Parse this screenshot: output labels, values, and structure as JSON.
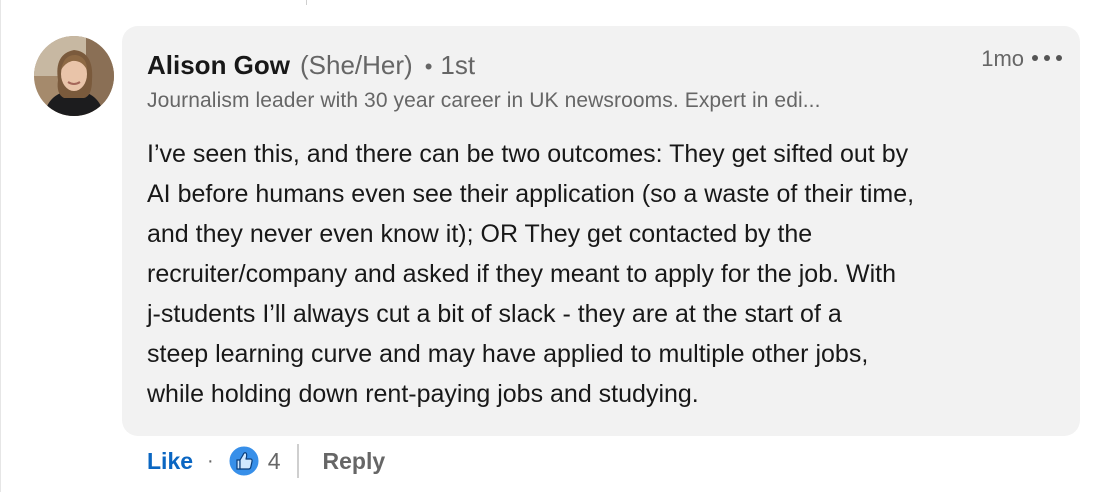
{
  "author": {
    "name": "Alison Gow",
    "pronouns": "(She/Her)",
    "separator": "•",
    "degree": "1st",
    "headline": "Journalism leader with 30 year career in UK newsrooms. Expert in edi...",
    "avatar_icon": "profile-photo"
  },
  "meta": {
    "timestamp": "1mo",
    "more_icon": "ellipsis-icon"
  },
  "comment": {
    "lines": [
      "I’ve seen this, and there can be two outcomes: They get sifted out by",
      "AI before humans even see their application (so a waste of their time,",
      "and they never even know it); OR They get contacted by the",
      "recruiter/company and asked if they meant to apply for the job. With",
      "j-students I’ll always cut a bit of slack - they are at the start of a",
      "steep learning curve and may have applied to multiple other jobs,",
      "while holding down rent-paying jobs and studying."
    ]
  },
  "actions": {
    "like_label": "Like",
    "dot": "·",
    "reaction_icon": "thumbs-up-icon",
    "reaction_count": "4",
    "reply_label": "Reply"
  },
  "colors": {
    "bubble": "#f2f2f2",
    "like_blue": "#0a66c2",
    "secondary_text": "#666666"
  }
}
